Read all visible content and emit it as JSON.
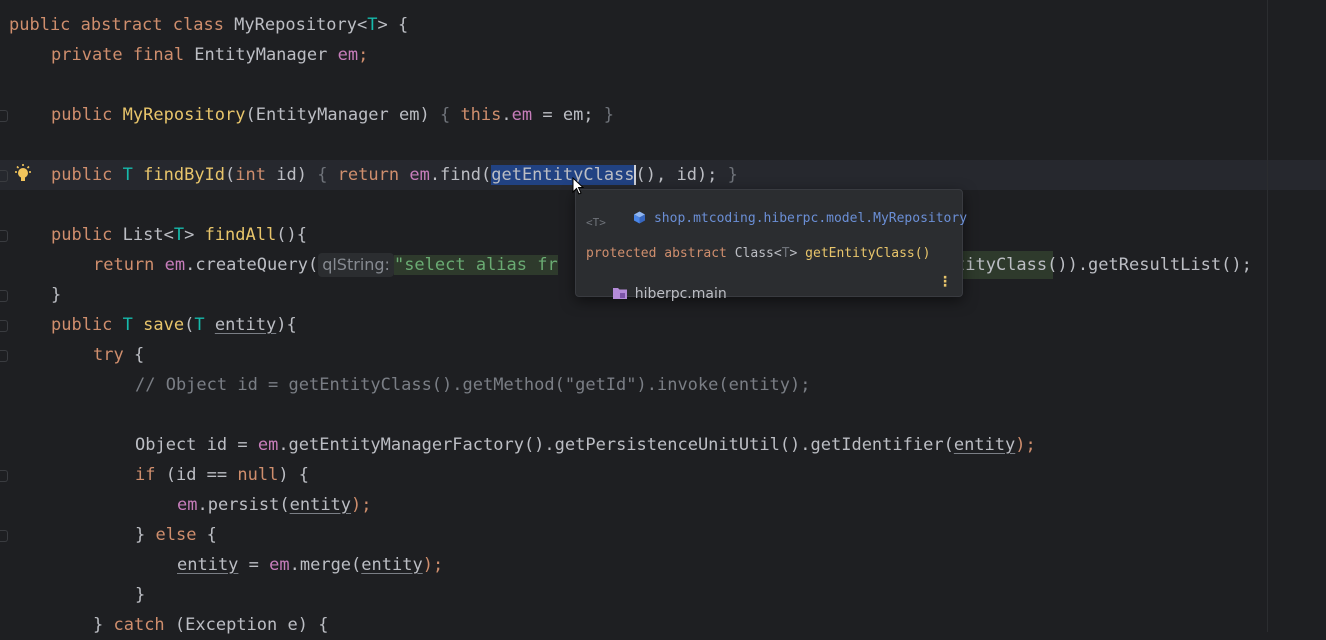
{
  "colors": {
    "background": "#1e1f22",
    "keyword": "#cf8e6d",
    "method_decl": "#e8c56b",
    "field": "#c77dbb",
    "type_param": "#16baac",
    "string": "#6aab73",
    "comment": "#7a7e85",
    "selection": "#214283"
  },
  "code": {
    "l1": {
      "kw": "public abstract class ",
      "name": "MyRepository",
      "lt": "<",
      "tp": "T",
      "rest": "> {"
    },
    "l2": {
      "kw": "private final ",
      "type": "EntityManager ",
      "field": "em",
      "semi": ";"
    },
    "l4": {
      "kw": "public ",
      "name": "MyRepository",
      "params": "(EntityManager em) ",
      "ob": "{ ",
      "this": "this",
      "dot": ".",
      "field": "em",
      "assign": " = em; ",
      "cb": "}"
    },
    "l6": {
      "kw": "public ",
      "tp": "T ",
      "name": "findById",
      "params": "(",
      "int": "int",
      "p2": " id) ",
      "ob": "{ ",
      "ret": "return ",
      "field": "em",
      "call": ".find(",
      "sel": "getEntityClass",
      "args": "(), id); ",
      "cb": "}"
    },
    "l8": {
      "kw": "public ",
      "type": "List<",
      "tp": "T",
      "gt": "> ",
      "name": "findAll",
      "rest": "(){"
    },
    "l9": {
      "ret": "return ",
      "field": "em",
      "call": ".createQuery(",
      "hint": "qlString:",
      "str": "\"select alias fr",
      "tail": "tityClass()).getResultList();"
    },
    "l10": {
      "text": "}"
    },
    "l11": {
      "kw": "public ",
      "tp": "T ",
      "name": "save",
      "open": "(",
      "tp2": "T ",
      "param": "entity",
      "rest": "){"
    },
    "l12": {
      "kw": "try",
      "rest": " {"
    },
    "l13": {
      "comment": "// Object id = getEntityClass().getMethod(\"getId\").invoke(entity);"
    },
    "l15": {
      "pre": "Object id = ",
      "field": "em",
      "call": ".getEntityManagerFactory().getPersistenceUnitUtil().getIdentifier(",
      "param": "entity",
      "end": ");"
    },
    "l16": {
      "kw": "if",
      "mid": " (id == ",
      "null": "null",
      "rest": ") {"
    },
    "l17": {
      "field": "em",
      "call": ".persist(",
      "param": "entity",
      "end": ");"
    },
    "l18": {
      "pre": "} ",
      "kw": "else",
      "rest": " {"
    },
    "l19": {
      "param": "entity",
      "mid": " = ",
      "field": "em",
      "call": ".merge(",
      "param2": "entity",
      "end": ");"
    },
    "l20": {
      "text": "}"
    },
    "l21": {
      "pre": "} ",
      "kw": "catch",
      "rest": " (Exception e) {"
    }
  },
  "popup": {
    "icon": "class-icon",
    "package": "shop.mtcoding.hiberpc.model.MyRepository",
    "type_params": "<T>",
    "sig_kw": "protected abstract ",
    "sig_type": "Class<",
    "sig_tp": "T",
    "sig_gt": "> ",
    "sig_name": "getEntityClass()",
    "module": "hiberpc.main",
    "more": "⋮"
  }
}
